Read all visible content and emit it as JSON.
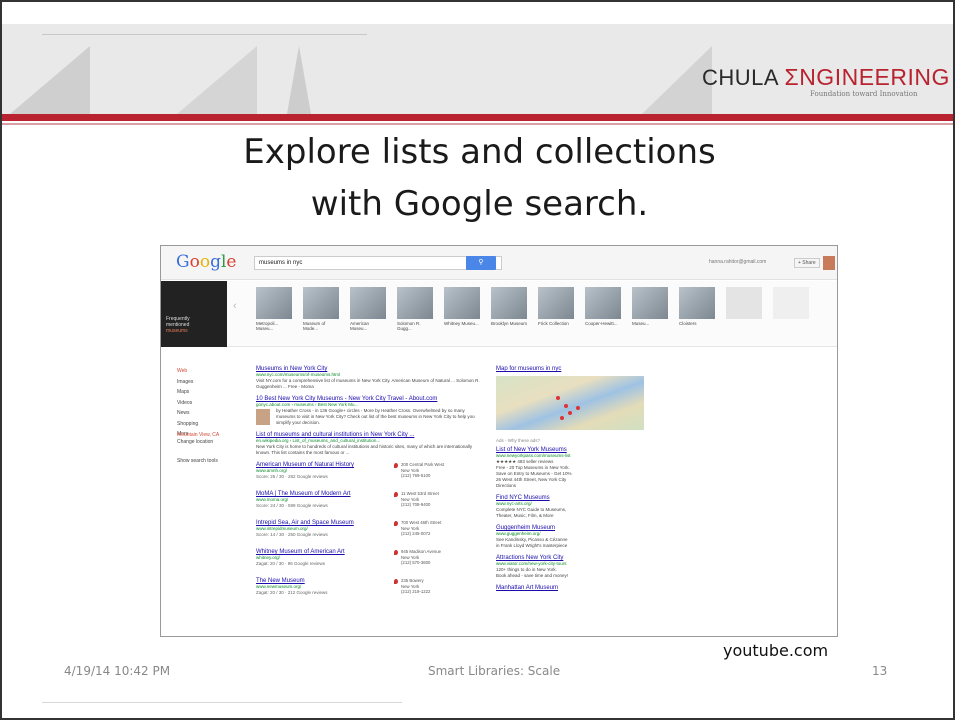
{
  "slide": {
    "logo": {
      "chula": "CHULA",
      "engineering": "ΣNGINEERING",
      "tagline": "Foundation toward Innovation"
    },
    "title_line1": "Explore lists and collections",
    "title_line2": "with Google search.",
    "source": "youtube.com",
    "footer": {
      "date": "4/19/14 10:42 PM",
      "center": "Smart Libraries: Scale",
      "page": "13"
    },
    "accent_color": "#b8232f"
  },
  "google": {
    "logo": [
      "G",
      "o",
      "o",
      "g",
      "l",
      "e"
    ],
    "query": "museums in nyc",
    "search_icon": "search-icon",
    "user": "hanna.rahitor@gmail.com",
    "share_label": "+ Share",
    "frequent": {
      "line1": "Frequently",
      "line2": "mentioned",
      "line3": "museums"
    },
    "carousel": [
      {
        "label": "Metropoli... Museu..."
      },
      {
        "label": "Museum of Mode..."
      },
      {
        "label": "American Museu..."
      },
      {
        "label": "Solomon R. Gugg..."
      },
      {
        "label": "Whitney Museu..."
      },
      {
        "label": "Brooklyn Museum"
      },
      {
        "label": "Frick Collection"
      },
      {
        "label": "Cooper-Hewitt..."
      },
      {
        "label": "Museu..."
      },
      {
        "label": "Cloisters"
      }
    ],
    "nav": [
      "Web",
      "Images",
      "Maps",
      "Videos",
      "News",
      "Shopping",
      "More"
    ],
    "location": {
      "place": "Mountain View, CA",
      "change": "Change location"
    },
    "show_tools": "Show search tools",
    "results": [
      {
        "title": "Museums in New York City",
        "url": "www.nyc.com/museums/of-museums.html",
        "snippet": "Visit NY.com for a comprehensive list of museums in New York City. American Museum of Natural ... Solomon R. Guggenheim ... Free - Moma"
      },
      {
        "title": "10 Best New York City Museums - New York City Travel - About.com",
        "url": "gonyc.about.com › museums › Best New York Mu...",
        "snippet": "by Heather Cross - in 136 Google+ circles - More by Heather Cross. Overwhelmed by so many museums to visit in New York City? Check out list of the best museums in New York City to help you simplify your decision."
      },
      {
        "title": "List of museums and cultural institutions in New York City ...",
        "url": "en.wikipedia.org › List_of_museums_and_cultural_institution...",
        "snippet": "New York City is home to hundreds of cultural institutions and historic sites, many of which are internationally known. This list contains the most famous or ..."
      }
    ],
    "local": [
      {
        "title": "American Museum of Natural History",
        "url": "www.amnh.org/",
        "reviews": "Score: 25 / 30 · 282 Google reviews",
        "addr1": "200 Central Park West",
        "addr2": "New York",
        "phone": "(212) 769-5100"
      },
      {
        "title": "MoMA | The Museum of Modern Art",
        "url": "www.moma.org/",
        "reviews": "Score: 24 / 30 · 599 Google reviews",
        "addr1": "11 West 53rd Street",
        "addr2": "New York",
        "phone": "(212) 708-9400"
      },
      {
        "title": "Intrepid Sea, Air and Space Museum",
        "url": "www.intrepidmuseum.org/",
        "reviews": "Score: 14 / 30 · 250 Google reviews",
        "addr1": "700 West 46th Street",
        "addr2": "New York",
        "phone": "(212) 245-0072"
      },
      {
        "title": "Whitney Museum of American Art",
        "url": "whitney.org/",
        "reviews": "Zagat: 20 / 30 · 96 Google reviews",
        "addr1": "945 Madison Avenue",
        "addr2": "New York",
        "phone": "(212) 570-3600"
      },
      {
        "title": "The New Museum",
        "url": "www.newmuseum.org/",
        "reviews": "Zagat: 20 / 30 · 212 Google reviews",
        "addr1": "235 Bowery",
        "addr2": "New York",
        "phone": "(212) 219-1222"
      }
    ],
    "map_title": "Map for museums in nyc",
    "ads_note": "Ads - Why these ads?",
    "ads": [
      {
        "title": "List of New York Museums",
        "url": "www.newyorkpass.com/museums-list",
        "lines": [
          "★★★★★ 483 seller reviews",
          "Free - 20 Top Museums in New York.",
          "Save on Entry to Museums - Get 10%",
          "26 West 44th Street, New York City",
          "Directions"
        ]
      },
      {
        "title": "Find NYC Museums",
        "url": "www.nyc-arts.org/",
        "lines": [
          "Complete NYC Guide to Museums,",
          "Theater, Music, Film, & More"
        ]
      },
      {
        "title": "Guggenheim Museum",
        "url": "www.guggenheim.org/",
        "lines": [
          "See Kandinsky, Picasso & Cézanne",
          "in Frank Lloyd Wright's masterpiece"
        ]
      },
      {
        "title": "Attractions New York City",
        "url": "www.viator.com/new-york-city-tours",
        "lines": [
          "120+ things to do in New York.",
          "Book ahead - save time and money!"
        ]
      },
      {
        "title": "Manhattan Art Museum",
        "url": "",
        "lines": []
      }
    ]
  }
}
